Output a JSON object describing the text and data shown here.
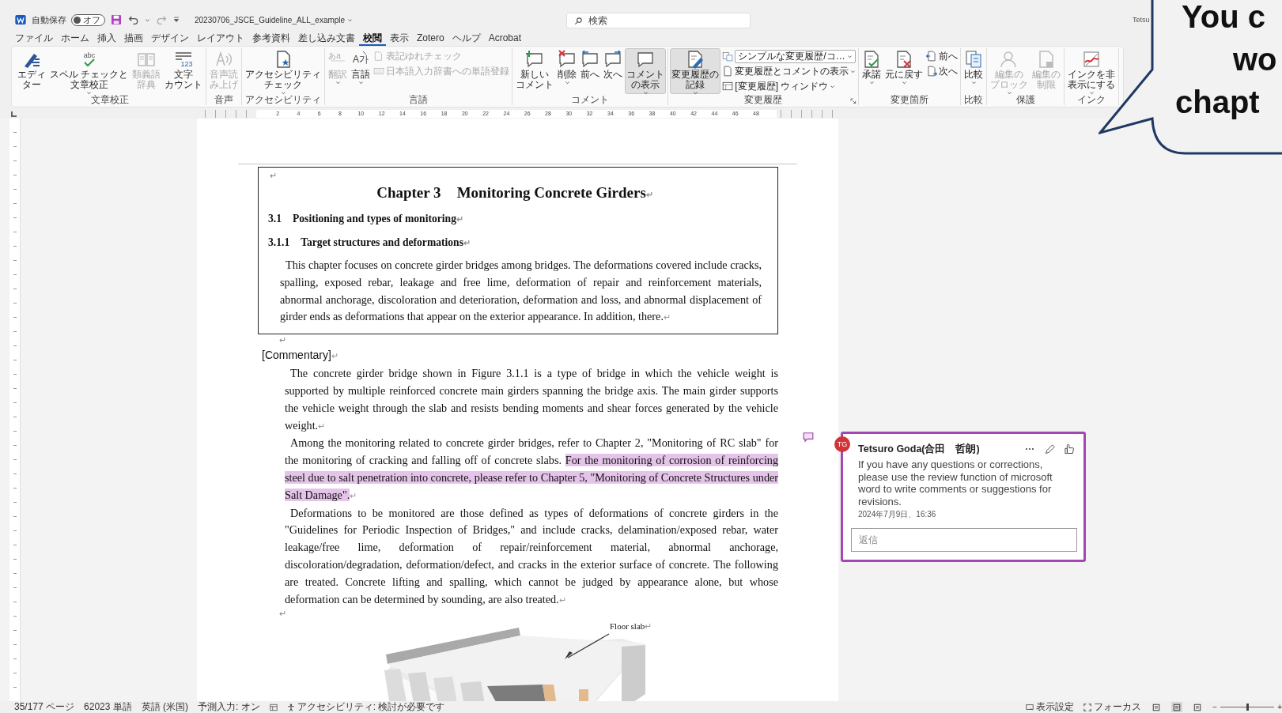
{
  "title_bar": {
    "autosave_label": "自動保存",
    "autosave": {
      "on": false,
      "label": "オフ"
    },
    "file_name": "20230706_JSCE_Guideline_ALL_example",
    "search": {
      "placeholder": "検索"
    },
    "user": "Tetsu"
  },
  "tabs": [
    {
      "label": "ファイル",
      "selected": false
    },
    {
      "label": "ホーム",
      "selected": false
    },
    {
      "label": "挿入",
      "selected": false
    },
    {
      "label": "描画",
      "selected": false
    },
    {
      "label": "デザイン",
      "selected": false
    },
    {
      "label": "レイアウト",
      "selected": false
    },
    {
      "label": "参考資料",
      "selected": false
    },
    {
      "label": "差し込み文書",
      "selected": false
    },
    {
      "label": "校閲",
      "selected": true
    },
    {
      "label": "表示",
      "selected": false
    },
    {
      "label": "Zotero",
      "selected": false
    },
    {
      "label": "ヘルプ",
      "selected": false
    },
    {
      "label": "Acrobat",
      "selected": false
    }
  ],
  "ribbon": {
    "groups": [
      {
        "label": "文章校正",
        "dialog_launcher": false,
        "items": [
          {
            "kind": "large",
            "label": "エディター",
            "dropdown": false,
            "disabled": false,
            "pressed": false
          },
          {
            "kind": "large",
            "label": "スペル チェックと文章校正",
            "icon_text": "abc",
            "dropdown": true,
            "disabled": false,
            "pressed": false
          },
          {
            "kind": "large",
            "label": "類義語辞典",
            "dropdown": false,
            "disabled": true,
            "pressed": false
          },
          {
            "kind": "large",
            "label": "文字カウント",
            "icon_text": "123",
            "dropdown": false,
            "disabled": false,
            "pressed": false
          }
        ]
      },
      {
        "label": "音声",
        "dialog_launcher": false,
        "items": [
          {
            "kind": "large",
            "label": "音声読み上げ",
            "dropdown": false,
            "disabled": true,
            "pressed": false
          }
        ]
      },
      {
        "label": "アクセシビリティ",
        "dialog_launcher": false,
        "items": [
          {
            "kind": "large",
            "label": "アクセシビリティチェック",
            "dropdown": true,
            "disabled": false,
            "pressed": false
          }
        ]
      },
      {
        "label": "言語",
        "dialog_launcher": false,
        "items": [
          {
            "kind": "large",
            "label": "翻訳",
            "icon_text": "あa",
            "dropdown": true,
            "disabled": true,
            "pressed": false
          },
          {
            "kind": "large",
            "label": "言語",
            "icon_text": "A가",
            "dropdown": true,
            "disabled": false,
            "pressed": false
          },
          {
            "kind": "stack",
            "items": [
              {
                "kind": "small",
                "label": "表記ゆれチェック",
                "dropdown": false,
                "disabled": true
              },
              {
                "kind": "small",
                "label": "日本語入力辞書への単語登録",
                "dropdown": false,
                "disabled": true
              }
            ]
          }
        ]
      },
      {
        "label": "コメント",
        "dialog_launcher": false,
        "items": [
          {
            "kind": "large",
            "label": "新しいコメント",
            "dropdown": false,
            "disabled": false,
            "pressed": false
          },
          {
            "kind": "large",
            "label": "削除",
            "dropdown": true,
            "disabled": false,
            "pressed": false
          },
          {
            "kind": "large",
            "label": "前へ",
            "dropdown": false,
            "disabled": false,
            "pressed": false
          },
          {
            "kind": "large",
            "label": "次へ",
            "dropdown": false,
            "disabled": false,
            "pressed": false
          },
          {
            "kind": "large",
            "label": "コメントの表示",
            "dropdown": true,
            "disabled": false,
            "pressed": true
          }
        ]
      },
      {
        "label": "変更履歴",
        "dialog_launcher": true,
        "items": [
          {
            "kind": "large",
            "label": "変更履歴の記録",
            "dropdown": true,
            "disabled": false,
            "pressed": true
          },
          {
            "kind": "stack",
            "items": [
              {
                "kind": "select",
                "label": "シンプルな変更履歴/コ…",
                "dropdown": true,
                "disabled": false
              },
              {
                "kind": "small",
                "label": "変更履歴とコメントの表示",
                "dropdown": true,
                "disabled": false
              },
              {
                "kind": "small",
                "label": "[変更履歴] ウィンドウ",
                "dropdown": true,
                "disabled": false
              }
            ]
          }
        ]
      },
      {
        "label": "変更箇所",
        "dialog_launcher": false,
        "items": [
          {
            "kind": "large",
            "label": "承諾",
            "dropdown": true,
            "disabled": false,
            "pressed": false
          },
          {
            "kind": "large",
            "label": "元に戻す",
            "dropdown": true,
            "disabled": false,
            "pressed": false
          },
          {
            "kind": "stack",
            "items": [
              {
                "kind": "small",
                "label": "前へ",
                "dropdown": false,
                "disabled": false
              },
              {
                "kind": "small",
                "label": "次へ",
                "dropdown": false,
                "disabled": false
              }
            ]
          }
        ]
      },
      {
        "label": "比較",
        "dialog_launcher": false,
        "items": [
          {
            "kind": "large",
            "label": "比較",
            "dropdown": true,
            "disabled": false,
            "pressed": false
          }
        ]
      },
      {
        "label": "保護",
        "dialog_launcher": false,
        "items": [
          {
            "kind": "large",
            "label": "編集のブロック",
            "dropdown": true,
            "disabled": true,
            "pressed": false
          },
          {
            "kind": "large",
            "label": "編集の制限",
            "dropdown": false,
            "disabled": true,
            "pressed": false
          }
        ]
      },
      {
        "label": "インク",
        "dialog_launcher": false,
        "items": [
          {
            "kind": "large",
            "label": "インクを非表示にする",
            "dropdown": true,
            "disabled": false,
            "pressed": false
          }
        ]
      }
    ]
  },
  "ruler": {
    "numbers": [
      "2",
      "4",
      "6",
      "8",
      "10",
      "12",
      "14",
      "16",
      "18",
      "20",
      "22",
      "24",
      "26",
      "28",
      "30",
      "32",
      "34",
      "36",
      "38",
      "40",
      "42",
      "44",
      "46",
      "48"
    ]
  },
  "document": {
    "frame": [
      {
        "kind": "empty",
        "end_mark": "↵"
      },
      {
        "kind": "title",
        "number": "Chapter 3",
        "text": "Monitoring Concrete Girders",
        "end_mark": "↵"
      },
      {
        "kind": "heading",
        "number": "3.1",
        "text": "Positioning and types of monitoring",
        "end_mark": "↵"
      },
      {
        "kind": "heading",
        "number": "3.1.1",
        "text": "Target structures and deformations",
        "end_mark": "↵"
      },
      {
        "kind": "body",
        "segments": [
          {
            "text": "This chapter focuses on concrete girder bridges among bridges. The deformations covered include cracks, spalling, exposed rebar, leakage and free lime, deformation of repair and reinforcement materials, abnormal anchorage, discoloration and deterioration, deformation and loss, and abnormal displacement of girder ends as deformations that appear on the exterior appearance. In addition, there.",
            "commented": false
          }
        ],
        "end_mark": "↵"
      }
    ],
    "paragraphs": [
      {
        "kind": "empty",
        "end_mark": "↵"
      },
      {
        "kind": "label",
        "text": "[Commentary]",
        "end_mark": "↵"
      },
      {
        "kind": "body",
        "segments": [
          {
            "text": "The concrete girder bridge shown in Figure 3.1.1 is a type of bridge in which the vehicle weight is supported by multiple reinforced concrete main girders spanning the bridge axis. The main girder supports the vehicle weight through the slab and resists bending moments and shear forces generated by the vehicle weight.",
            "commented": false
          }
        ],
        "end_mark": "↵"
      },
      {
        "kind": "body",
        "segments": [
          {
            "text": "Among the monitoring related to concrete girder bridges, refer to Chapter 2, \"Monitoring of RC slab\" for the monitoring of cracking and falling off of concrete slabs. ",
            "commented": false
          },
          {
            "text": "For the monitoring of corrosion of reinforcing steel due to salt penetration into concrete, please refer to Chapter 5, \"Monitoring of Concrete Structures under Salt Damage\".",
            "commented": true
          }
        ],
        "end_mark": "↵"
      },
      {
        "kind": "body",
        "segments": [
          {
            "text": "Deformations to be monitored are those defined as types of deformations of concrete girders in the \"Guidelines for Periodic Inspection of Bridges,\" and include cracks, delamination/exposed rebar, water leakage/free lime, deformation of repair/reinforcement material, abnormal anchorage, discoloration/degradation, deformation/defect, and cracks in the exterior surface of concrete. The following are treated. Concrete lifting and spalling, which cannot be judged by appearance alone, but whose deformation can be determined by sounding, are also treated.",
            "commented": false
          }
        ],
        "end_mark": "↵"
      },
      {
        "kind": "empty",
        "end_mark": "↵"
      }
    ],
    "figure": {
      "kind": "picture",
      "label": "Floor slab",
      "end_mark": "↵"
    }
  },
  "comment": {
    "initials": "TG",
    "author": "Tetsuro Goda(合田　哲朗)",
    "text": "If you have any questions or corrections, please use the review function of microsoft word to write comments or suggestions for revisions.",
    "date": "2024年7月9日、16:36",
    "reply": {
      "placeholder": "返信"
    }
  },
  "status_bar": {
    "left": [
      "35/177 ページ",
      "62023 単語",
      "英語 (米国)",
      "予測入力: オン"
    ],
    "accessibility": "アクセシビリティ: 検討が必要です",
    "display_settings": "表示設定",
    "focus": "フォーカス",
    "views": [
      {
        "selected": false
      },
      {
        "selected": true
      },
      {
        "selected": false
      }
    ],
    "zoom": {
      "minus": "−",
      "plus": "+",
      "level": 0.5
    }
  },
  "callout": {
    "lines": [
      "You c",
      "wo",
      "chapt"
    ]
  }
}
